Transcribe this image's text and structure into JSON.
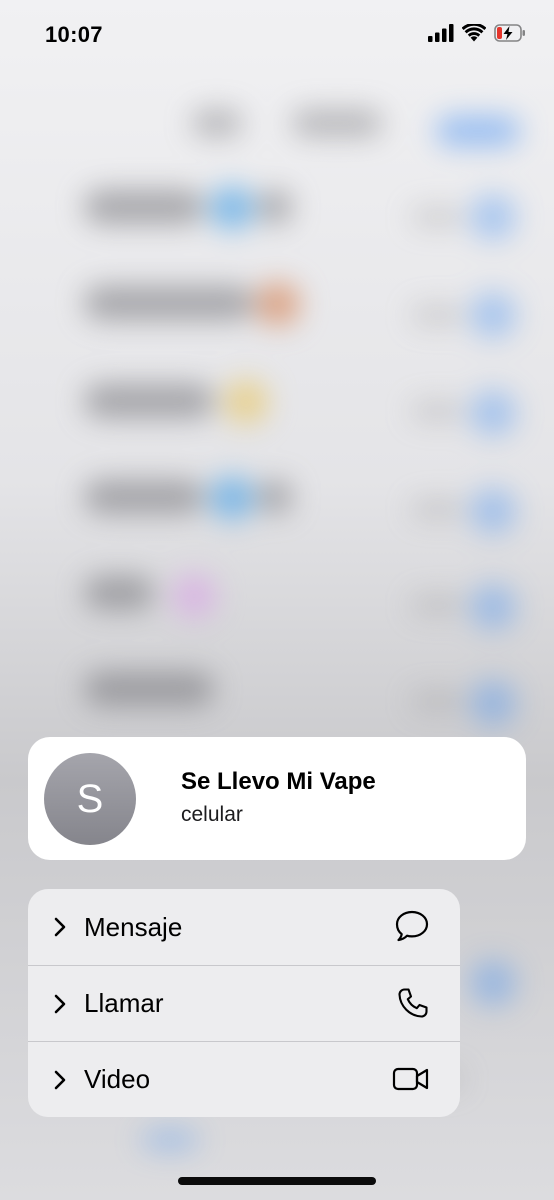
{
  "status_bar": {
    "time": "10:07",
    "icons": [
      "signal-icon",
      "wifi-icon",
      "battery-charging-icon"
    ],
    "battery_color": "#e5342b"
  },
  "contact": {
    "initial": "S",
    "name": "Se Llevo Mi Vape",
    "label": "celular"
  },
  "menu": {
    "items": [
      {
        "label": "Mensaje",
        "icon": "message-bubble-icon"
      },
      {
        "label": "Llamar",
        "icon": "phone-icon"
      },
      {
        "label": "Video",
        "icon": "video-camera-icon"
      }
    ]
  },
  "colors": {
    "accent": "#2f83f3",
    "card": "#ffffff",
    "menu": "#ededef"
  }
}
